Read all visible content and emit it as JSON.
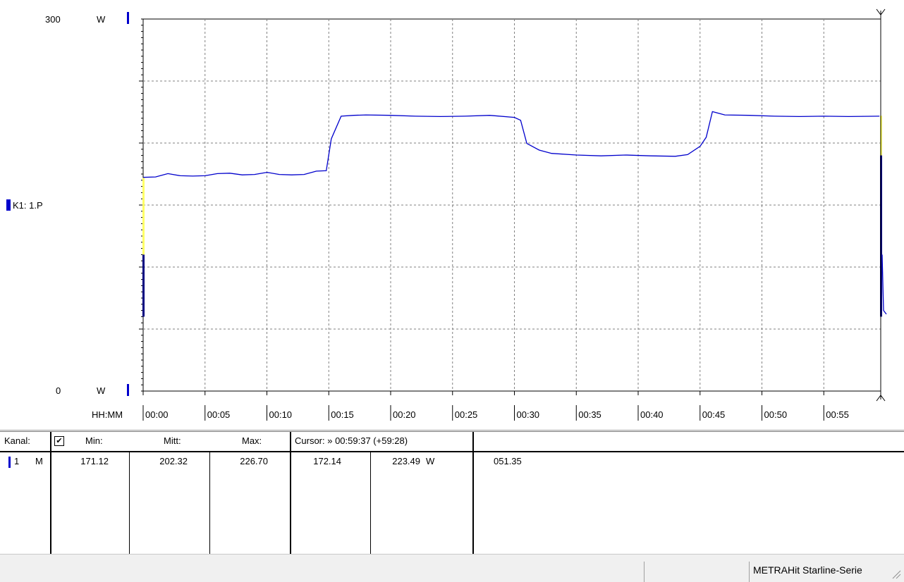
{
  "chart_data": {
    "type": "line",
    "y_axis": {
      "top_label": "300",
      "bottom_label": "0",
      "unit": "W",
      "ylim": [
        0,
        300
      ]
    },
    "x_axis": {
      "label": "HH:MM",
      "tick_labels": [
        "00:00",
        "00:05",
        "00:10",
        "00:15",
        "00:20",
        "00:25",
        "00:30",
        "00:35",
        "00:40",
        "00:45",
        "00:50",
        "00:55"
      ],
      "xlim_minutes": [
        0,
        59.6
      ]
    },
    "grid": true,
    "series": [
      {
        "name": "K1: 1.P",
        "color": "#0000cc",
        "x_minutes": [
          0,
          1,
          2,
          3,
          4,
          5,
          6,
          7,
          8,
          9,
          10,
          11,
          12,
          13,
          14,
          14.8,
          15.2,
          16,
          17,
          18,
          20,
          22,
          24,
          26,
          28,
          30,
          30.5,
          31,
          32,
          33,
          35,
          37,
          39,
          41,
          43,
          44,
          45,
          45.5,
          46,
          47,
          49,
          51,
          53,
          55,
          57,
          59.5
        ],
        "y": [
          172,
          173,
          175,
          174,
          173,
          174,
          175,
          176,
          174,
          175,
          176,
          175,
          174,
          175,
          177,
          178,
          203,
          222,
          222,
          223,
          222,
          222,
          221,
          222,
          222,
          221,
          218,
          200,
          194,
          192,
          190,
          190,
          190,
          190,
          189,
          191,
          197,
          205,
          225,
          223,
          222,
          222,
          221,
          222,
          221,
          222
        ]
      }
    ],
    "cursor": {
      "color": "#000000",
      "x_minutes": 59.6
    }
  },
  "table": {
    "headers": {
      "kanal": "Kanal:",
      "min": "Min:",
      "mitt": "Mitt:",
      "max": "Max:",
      "cursor": "Cursor: » 00:59:37 (+59:28)"
    },
    "checkbox_mark": "✔",
    "row": {
      "channel": "1",
      "mode": "M",
      "min": "171.12",
      "mitt": "202.32",
      "max": "226.70",
      "cur1": "172.14",
      "cur2": "223.49",
      "unit": "W",
      "extra": "051.35"
    }
  },
  "status_bar": {
    "text": "METRAHit Starline-Serie"
  }
}
